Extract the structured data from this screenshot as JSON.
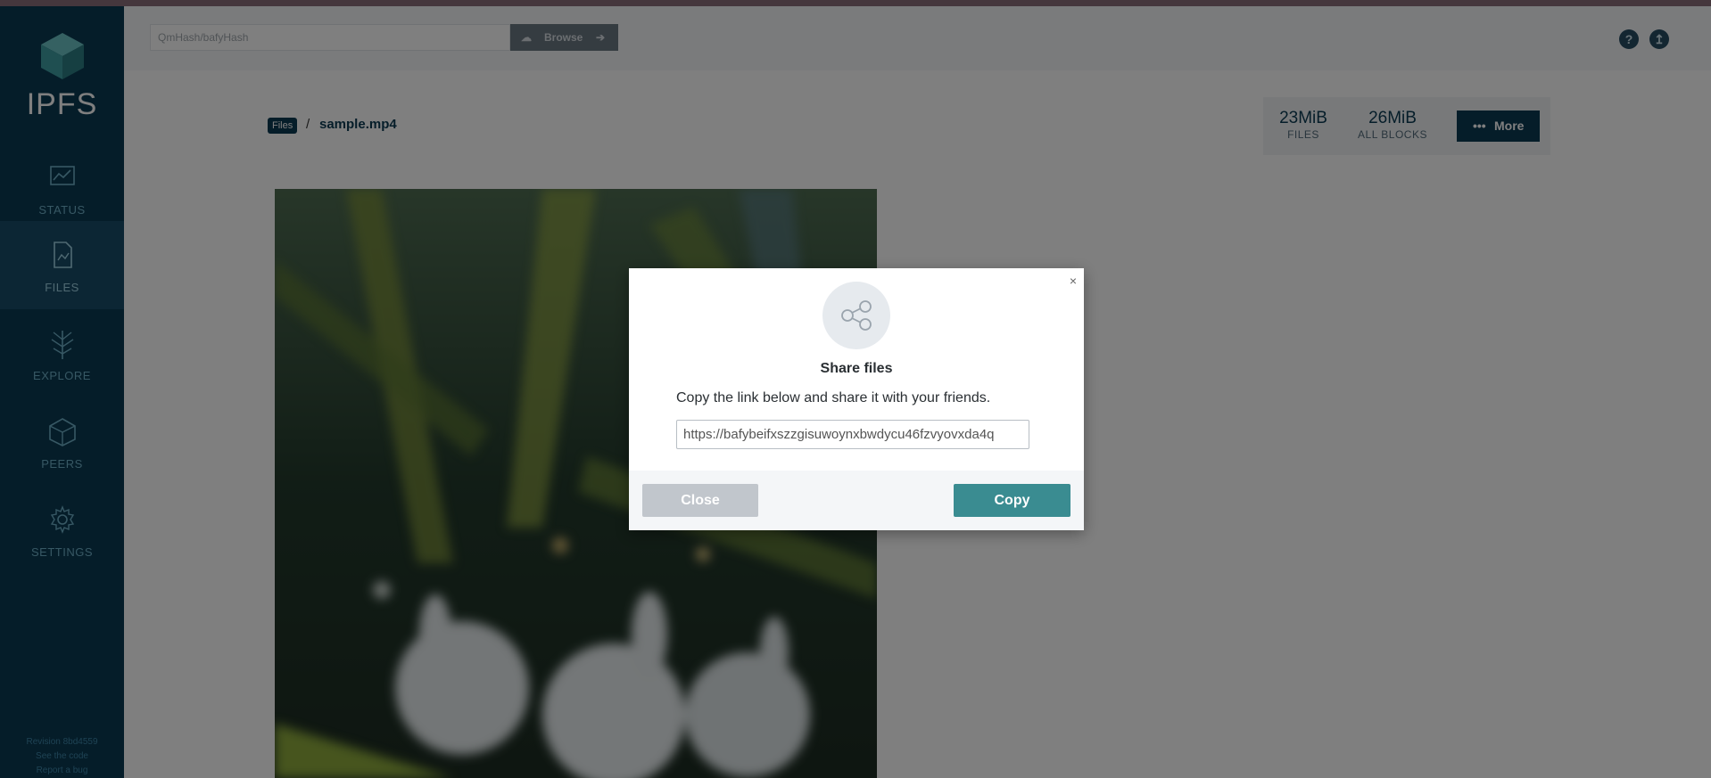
{
  "app": {
    "logo_text": "IPFS"
  },
  "sidebar": {
    "items": [
      {
        "label": "STATUS",
        "icon": "status-icon"
      },
      {
        "label": "FILES",
        "icon": "files-icon",
        "active": true
      },
      {
        "label": "EXPLORE",
        "icon": "explore-icon"
      },
      {
        "label": "PEERS",
        "icon": "peers-icon"
      },
      {
        "label": "SETTINGS",
        "icon": "settings-icon"
      }
    ],
    "footer": {
      "revision": "Revision 8bd4559",
      "code_link": "See the code",
      "bug_link": "Report a bug"
    }
  },
  "topbar": {
    "path_placeholder": "QmHash/bafyHash",
    "browse_label": "Browse",
    "help_icon": "?",
    "update_icon": "↥"
  },
  "breadcrumb": {
    "root": "Files",
    "separator": "/",
    "current": "sample.mp4"
  },
  "stats": {
    "files_size": "23MiB",
    "files_label": "FILES",
    "blocks_size": "26MiB",
    "blocks_label": "ALL BLOCKS",
    "more_label": "More"
  },
  "modal": {
    "close_x": "×",
    "title": "Share files",
    "description": "Copy the link below and share it with your friends.",
    "link": "https://bafybeifxszzgisuwoynxbwdycu46fzvyovxda4q",
    "close_label": "Close",
    "copy_label": "Copy"
  },
  "colors": {
    "sidebar": "#0b3a53",
    "accent": "#3a8c91",
    "overlay": "rgba(0,0,0,0.5)"
  }
}
